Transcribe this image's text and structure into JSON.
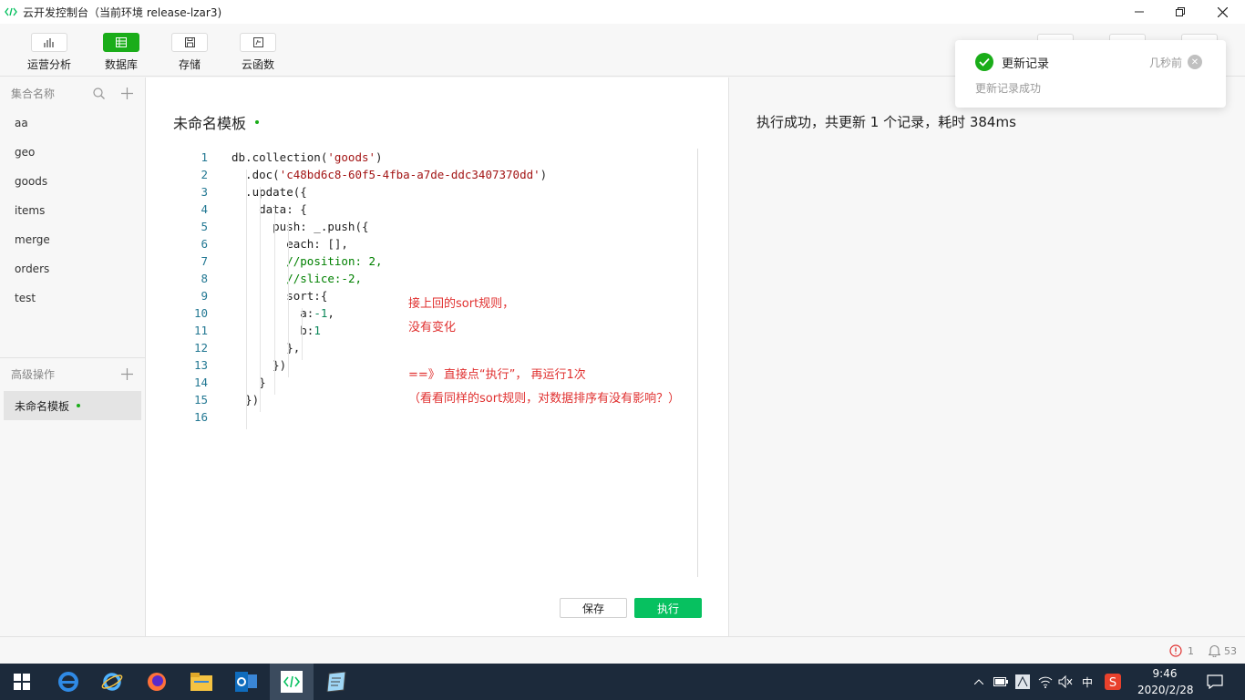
{
  "window": {
    "title": "云开发控制台（当前环境 release-lzar3)",
    "logo_icon": "code-bracket-icon",
    "controls": [
      "minimize",
      "restore",
      "close"
    ]
  },
  "toolbar": {
    "items": [
      {
        "label": "运营分析",
        "icon": "bar-chart-icon",
        "active": false
      },
      {
        "label": "数据库",
        "icon": "database-icon",
        "active": true
      },
      {
        "label": "存储",
        "icon": "storage-icon",
        "active": false
      },
      {
        "label": "云函数",
        "icon": "function-icon",
        "active": false
      }
    ]
  },
  "sidebar": {
    "collections_header": "集合名称",
    "collections": [
      "aa",
      "geo",
      "goods",
      "items",
      "merge",
      "orders",
      "test"
    ],
    "advanced_header": "高级操作",
    "templates": [
      {
        "label": "未命名模板",
        "unsaved": true
      }
    ]
  },
  "editor": {
    "title": "未命名模板",
    "line_numbers": [
      "1",
      "2",
      "3",
      "4",
      "5",
      "6",
      "7",
      "8",
      "9",
      "10",
      "11",
      "12",
      "13",
      "14",
      "15",
      "16"
    ],
    "annotation": {
      "line1": "接上回的sort规则，",
      "line2": "没有变化",
      "line3": "==》 直接点“执行”， 再运行1次",
      "line4": "（看看同样的sort规则，对数据排序有没有影响？）"
    },
    "save_label": "保存",
    "execute_label": "执行"
  },
  "result": {
    "text": "执行成功，共更新 1 个记录，耗时 384ms"
  },
  "toast": {
    "title": "更新记录",
    "time": "几秒前",
    "message": "更新记录成功"
  },
  "statusbar": {
    "errors": "1",
    "notifications": "53"
  },
  "taskbar": {
    "time": "9:46",
    "date": "2020/2/28",
    "ime": "中",
    "apps": [
      "windows-start-icon",
      "edge-icon",
      "ie-icon",
      "firefox-icon",
      "file-explorer-icon",
      "outlook-icon",
      "devtools-icon",
      "notepad-icon"
    ]
  },
  "colors": {
    "accent": "#07c160",
    "annotation": "#e0302f",
    "taskbar": "#1c2a3b"
  }
}
